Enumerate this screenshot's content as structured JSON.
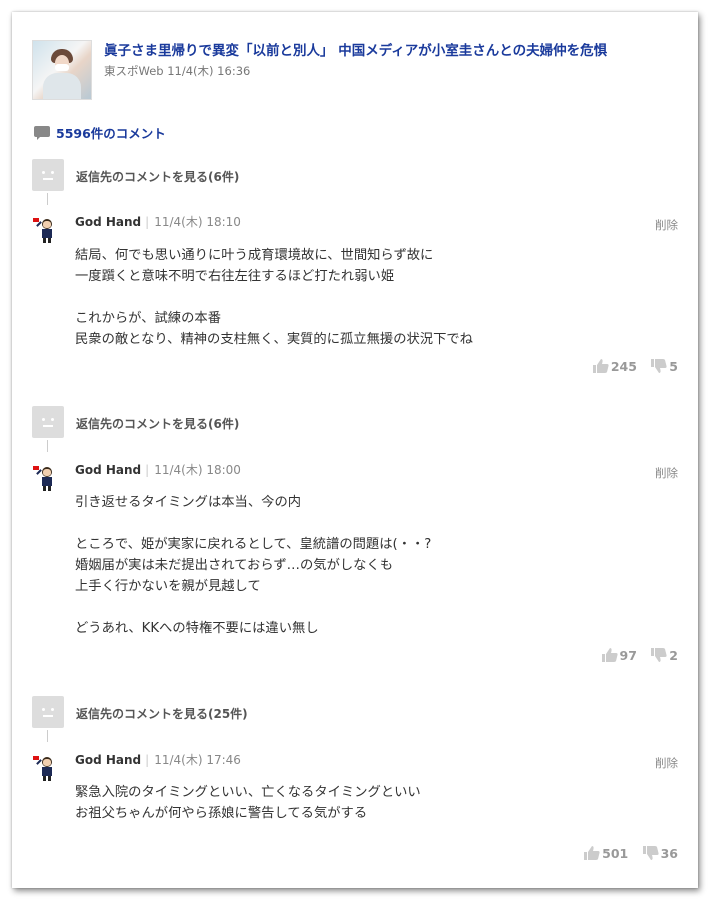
{
  "article": {
    "title": "眞子さま里帰りで異変「以前と別人」 中国メディアが小室圭さんとの夫婦仲を危惧",
    "source": "東スポWeb 11/4(木) 16:36"
  },
  "comment_count_label": "5596件のコメント",
  "blocks": [
    {
      "reply_label": "返信先のコメントを見る(6件)",
      "user": "God Hand",
      "time": "11/4(木) 18:10",
      "delete_label": "削除",
      "body": "結局、何でも思い通りに叶う成育環境故に、世間知らず故に\n一度躓くと意味不明で右往左往するほど打たれ弱い姫\n\nこれからが、試練の本番\n民衆の敵となり、精神の支柱無く、実質的に孤立無援の状況下でね",
      "likes": "245",
      "dislikes": "5"
    },
    {
      "reply_label": "返信先のコメントを見る(6件)",
      "user": "God Hand",
      "time": "11/4(木) 18:00",
      "delete_label": "削除",
      "body": "引き返せるタイミングは本当、今の内\n\nところで、姫が実家に戻れるとして、皇統譜の問題は(・・?\n婚姻届が実は未だ提出されておらず…の気がしなくも\n上手く行かないを親が見越して\n\nどうあれ、KKへの特権不要には違い無し",
      "likes": "97",
      "dislikes": "2"
    },
    {
      "reply_label": "返信先のコメントを見る(25件)",
      "user": "God Hand",
      "time": "11/4(木) 17:46",
      "delete_label": "削除",
      "body": "緊急入院のタイミングといい、亡くなるタイミングといい\nお祖父ちゃんが何やら孫娘に警告してる気がする",
      "likes": "501",
      "dislikes": "36"
    }
  ],
  "icons": {
    "comment": "speech-bubble-icon",
    "like": "thumbs-up-icon",
    "dislike": "thumbs-down-icon"
  },
  "colors": {
    "link": "#1a3a9c",
    "muted": "#888888"
  }
}
